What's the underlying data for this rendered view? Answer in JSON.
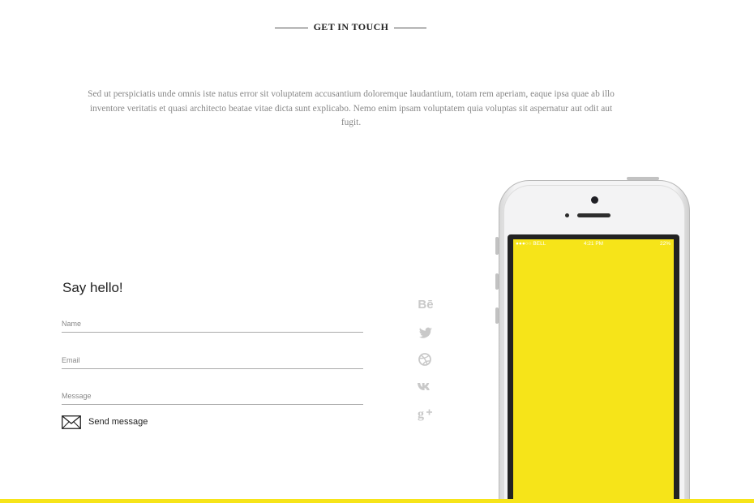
{
  "section": {
    "title": "GET IN TOUCH",
    "intro": "Sed ut perspiciatis unde omnis iste natus error sit voluptatem accusantium doloremque laudantium, totam rem aperiam, eaque ipsa quae ab illo inventore veritatis et quasi architecto beatae vitae dicta sunt explicabo. Nemo enim ipsam voluptatem quia voluptas sit aspernatur aut odit aut fugit."
  },
  "form": {
    "title": "Say hello!",
    "name_placeholder": "Name",
    "email_placeholder": "Email",
    "message_placeholder": "Message",
    "send_label": "Send message",
    "send_icon": "envelope-icon"
  },
  "social": [
    {
      "name": "behance-icon",
      "glyph": "Bē"
    },
    {
      "name": "twitter-icon"
    },
    {
      "name": "dribbble-icon"
    },
    {
      "name": "vk-icon"
    },
    {
      "name": "google-plus-icon"
    }
  ],
  "phone": {
    "status_carrier": "●●●○○ BELL ",
    "status_time": "4:21 PM",
    "status_battery": "22%",
    "screen_color": "#f6e419"
  },
  "colors": {
    "accent": "#f6e419",
    "social_icon": "#c9c9c9",
    "text_muted": "#888888"
  }
}
